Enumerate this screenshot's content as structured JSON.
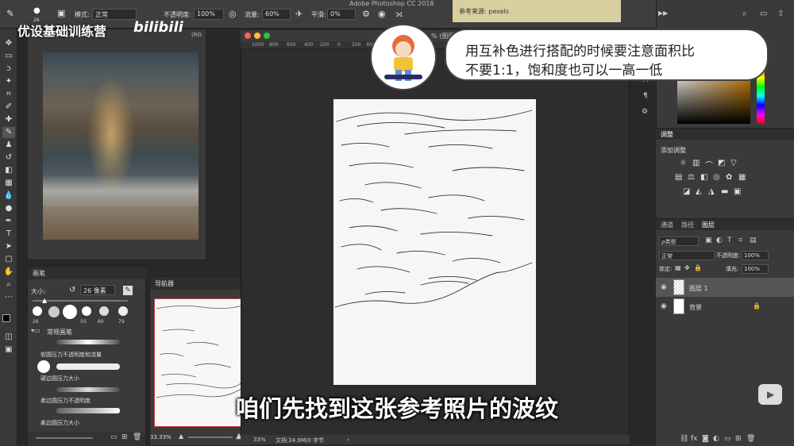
{
  "app": {
    "title": "Adobe Photoshop CC 2018"
  },
  "options_bar": {
    "brush_size": "26",
    "mode_label": "模式:",
    "mode_value": "正常",
    "opacity_label": "不透明度:",
    "opacity_value": "100%",
    "flow_label": "流量:",
    "flow_value": "60%",
    "smooth_label": "平滑:",
    "smooth_value": "0%"
  },
  "reference_note": {
    "text": "参考来源: pexels"
  },
  "reference_window": {
    "title": "(RG"
  },
  "brush_panel": {
    "title": "画笔",
    "size_label": "大小:",
    "size_value": "26 像素",
    "preset_sizes": [
      "26",
      "50",
      "60",
      "79"
    ],
    "group_name": "常规画笔",
    "brushes": [
      "软圆压力不透明度和流量",
      "硬边圆压力大小",
      "柔边圆压力不透明度",
      "柔边圆压力大小"
    ]
  },
  "navigator": {
    "title": "导航器",
    "zoom": "33.33%"
  },
  "document": {
    "title_fragment": "% (图层",
    "ruler_ticks": [
      "1000",
      "800",
      "600",
      "400",
      "200",
      "0",
      "200",
      "400"
    ],
    "status_zoom": "33%",
    "status_doc": "文档:24.9M/0 字节"
  },
  "adjustments": {
    "tab": "调整",
    "add_label": "添加调整"
  },
  "layers_panel": {
    "tabs": [
      "通道",
      "路径",
      "图层"
    ],
    "kind_filter": "ρ类型",
    "blend_mode": "正常",
    "opacity_label": "不透明度:",
    "opacity_value": "100%",
    "lock_label": "锁定:",
    "fill_label": "填充:",
    "fill_value": "100%",
    "layers": [
      {
        "name": "图层 1"
      },
      {
        "name": "背景"
      }
    ]
  },
  "overlay": {
    "brand": "优设基础训练营",
    "logo": "bilibili",
    "speech_line1": "用互补色进行搭配的时候要注意面积比",
    "speech_line2": "不要1:1，饱和度也可以一高一低",
    "subtitle": "咱们先找到这张参考照片的波纹"
  },
  "colors": {
    "accent": "#e08a00",
    "panel": "#3a3a3a",
    "canvas": "#f6f6f6"
  }
}
